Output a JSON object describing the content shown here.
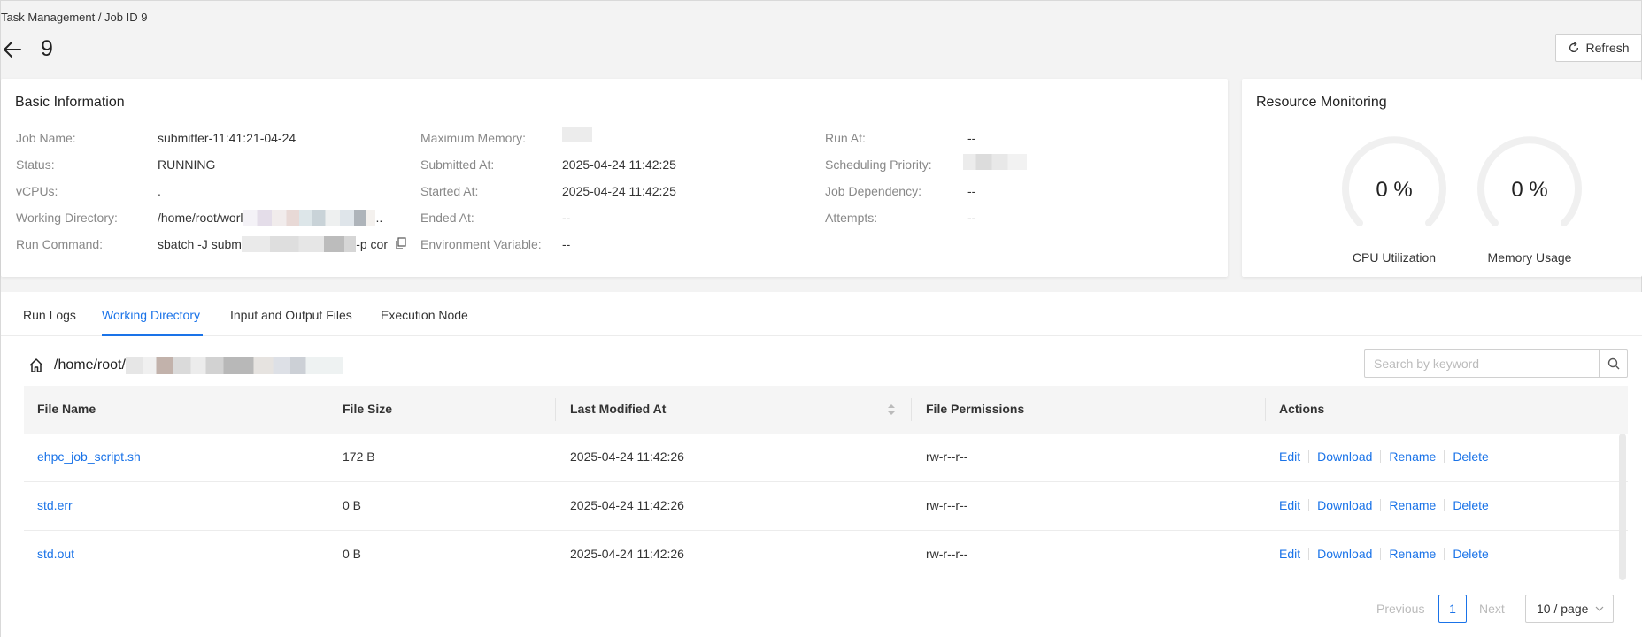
{
  "breadcrumb": "Task Management / Job ID 9",
  "page_title": "9",
  "refresh_label": "Refresh",
  "basic": {
    "title": "Basic Information",
    "job_name_label": "Job Name:",
    "job_name": "submitter-11:41:21-04-24",
    "status_label": "Status:",
    "status": "RUNNING",
    "vcpus_label": "vCPUs:",
    "vcpus": ".",
    "workdir_label": "Working Directory:",
    "workdir": "/home/root/worl",
    "workdir_tail": "..",
    "run_cmd_label": "Run Command:",
    "run_cmd_a": "sbatch -J subm",
    "run_cmd_b": "-p cor",
    "max_mem_label": "Maximum Memory:",
    "submitted_label": "Submitted At:",
    "submitted": "2025-04-24 11:42:25",
    "started_label": "Started At:",
    "started": "2025-04-24 11:42:25",
    "ended_label": "Ended At:",
    "ended": "--",
    "env_label": "Environment Variable:",
    "env": "--",
    "run_at_label": "Run At:",
    "run_at": "--",
    "priority_label": "Scheduling Priority:",
    "dependency_label": "Job Dependency:",
    "dependency": "--",
    "attempts_label": "Attempts:",
    "attempts": "--"
  },
  "resource": {
    "title": "Resource Monitoring",
    "cpu_value": "0 %",
    "cpu_label": "CPU Utilization",
    "mem_value": "0 %",
    "mem_label": "Memory Usage"
  },
  "tabs": [
    {
      "label": "Run Logs"
    },
    {
      "label": "Working Directory"
    },
    {
      "label": "Input and Output Files"
    },
    {
      "label": "Execution Node"
    }
  ],
  "path": "/home/root/",
  "search": {
    "placeholder": "Search by keyword"
  },
  "table": {
    "headers": {
      "file_name": "File Name",
      "file_size": "File Size",
      "modified": "Last Modified At",
      "permissions": "File Permissions",
      "actions": "Actions"
    },
    "rows": [
      {
        "name": "ehpc_job_script.sh",
        "size": "172 B",
        "modified": "2025-04-24 11:42:26",
        "perm": "rw-r--r--"
      },
      {
        "name": "std.err",
        "size": "0 B",
        "modified": "2025-04-24 11:42:26",
        "perm": "rw-r--r--"
      },
      {
        "name": "std.out",
        "size": "0 B",
        "modified": "2025-04-24 11:42:26",
        "perm": "rw-r--r--"
      }
    ],
    "action_labels": {
      "edit": "Edit",
      "download": "Download",
      "rename": "Rename",
      "delete": "Delete"
    }
  },
  "pagination": {
    "previous": "Previous",
    "current": "1",
    "next": "Next",
    "page_size": "10 / page"
  },
  "colors": {
    "accent": "#1a73e8",
    "background": "#f3f3f3"
  }
}
